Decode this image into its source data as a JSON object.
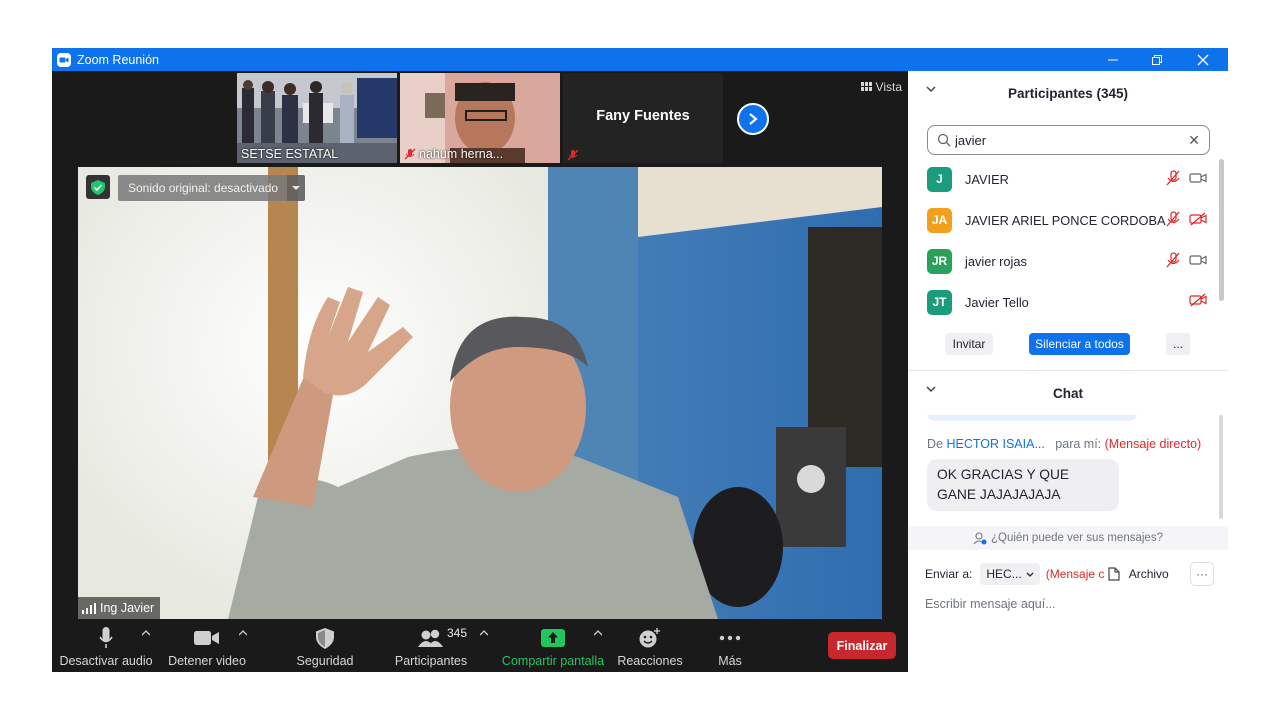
{
  "window": {
    "title": "Zoom Reunión"
  },
  "gallery": {
    "thumbs": [
      {
        "name": "SETSE ESTATAL"
      },
      {
        "name": "nahum herna..."
      },
      {
        "name": "Fany Fuentes"
      }
    ],
    "view_label": "Vista",
    "next_icon": "chevron-right-icon"
  },
  "main_video": {
    "sound_label": "Sonido original: desactivado",
    "speaker_name": "Ing Javier"
  },
  "toolbar": {
    "audio_label": "Desactivar audio",
    "video_label": "Detener video",
    "security_label": "Seguridad",
    "participants_label": "Participantes",
    "participants_count": "345",
    "share_label": "Compartir pantalla",
    "reactions_label": "Reacciones",
    "more_label": "Más",
    "end_label": "Finalizar",
    "share_color": "#22c55e",
    "end_color": "#c6282e"
  },
  "participants": {
    "header": "Participantes (345)",
    "search_value": "javier",
    "list": [
      {
        "initials": "J",
        "name": "JAVIER",
        "color": "#1a9c7d"
      },
      {
        "initials": "JA",
        "name": "JAVIER ARIEL PONCE CORDOBA",
        "color": "#f0a01a"
      },
      {
        "initials": "JR",
        "name": "javier rojas",
        "color": "#2aa15a"
      },
      {
        "initials": "JT",
        "name": "Javier Tello",
        "color": "#1a9c7d"
      }
    ],
    "invite_label": "Invitar",
    "mute_all_label": "Silenciar a todos",
    "more_label": "..."
  },
  "chat": {
    "header": "Chat",
    "message": {
      "prefix": "De",
      "from": "HECTOR ISAIA...",
      "to": "para mí:",
      "type": "(Mensaje directo)",
      "text": "OK GRACIAS Y QUE GANE JAJAJAJAJA"
    },
    "who_sees": "¿Quién puede ver sus mensajes?",
    "send_to_label": "Enviar a:",
    "send_to_value": "HEC...",
    "message_type_short": "(Mensaje c",
    "file_label": "Archivo",
    "more_label": "···",
    "input_placeholder": "Escribir mensaje aquí..."
  }
}
